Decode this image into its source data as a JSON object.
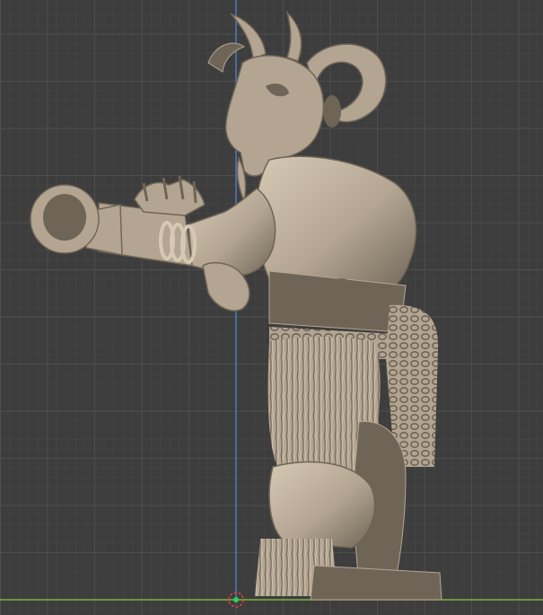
{
  "viewport": {
    "background_color": "#3d3d3d",
    "grid_minor_color": "#454545",
    "grid_major_color": "#4e4e4e",
    "x_axis_color": "#7cb340",
    "z_axis_color": "#4a78b8",
    "model_color": "#b3a592",
    "model_shadow_color": "#6f6557",
    "model_highlight_color": "#d6c9b4",
    "origin_marker_color": "#e04040",
    "origin_center_color": "#2fd05a"
  },
  "scene": {
    "object": "horned-creature-sculpt",
    "view": "side-orthographic",
    "shading": "solid"
  }
}
